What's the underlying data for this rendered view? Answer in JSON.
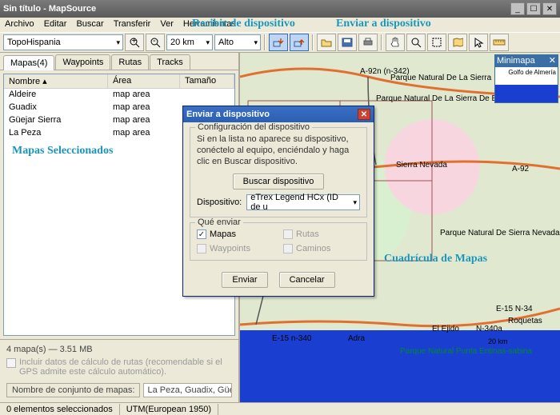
{
  "window": {
    "title": "Sin título - MapSource"
  },
  "menu": {
    "archivo": "Archivo",
    "editar": "Editar",
    "buscar": "Buscar",
    "transferir": "Transferir",
    "ver": "Ver",
    "herramientas": "Herramientas"
  },
  "annotations": {
    "recibir": "Recibir de dispositivo",
    "enviar": "Enviar a dispositivo",
    "mapas_sel": "Mapas Seleccionados",
    "cuadricula": "Cuadrícula de Mapas"
  },
  "toolbar": {
    "product": "TopoHispania",
    "zoom": "20 km",
    "detail": "Alto"
  },
  "tabs": {
    "mapas": "Mapas(4)",
    "waypoints": "Waypoints",
    "rutas": "Rutas",
    "tracks": "Tracks"
  },
  "list": {
    "headers": {
      "nombre": "Nombre",
      "area": "Área",
      "tamano": "Tamaño"
    },
    "rows": [
      {
        "nombre": "Aldeire",
        "area": "map area"
      },
      {
        "nombre": "Guadix",
        "area": "map area"
      },
      {
        "nombre": "Güejar Sierra",
        "area": "map area"
      },
      {
        "nombre": "La Peza",
        "area": "map area"
      }
    ]
  },
  "bottom": {
    "summary": "4 mapa(s) — 3.51 MB",
    "include": "Incluir datos de cálculo de rutas (recomendable si el GPS admite este cálculo automático).",
    "name_label": "Nombre de conjunto de mapas:",
    "name_value": "La Peza, Guadix, Güejar"
  },
  "dialog": {
    "title": "Enviar a dispositivo",
    "group1_legend": "Configuración del dispositivo",
    "group1_text": "Si en la lista no aparece su dispositivo, conéctelo al equipo, enciéndalo y haga clic en Buscar dispositivo.",
    "buscar": "Buscar dispositivo",
    "dispositivo_label": "Dispositivo:",
    "dispositivo_value": "eTrex Legend HCx (ID de u",
    "group2_legend": "Qué enviar",
    "chk_mapas": "Mapas",
    "chk_rutas": "Rutas",
    "chk_waypoints": "Waypoints",
    "chk_caminos": "Caminos",
    "enviar": "Enviar",
    "cancelar": "Cancelar"
  },
  "map_labels": {
    "a92n": "A-92n (n-342)",
    "pn_sierra": "Parque Natural De La Sierra",
    "pn_baza": "Parque Natural De La Sierra De Baza",
    "sierra_nevada": "Sierra Nevada",
    "a92": "A-92",
    "pn_sn": "Parque Natural De Sierra Nevada",
    "e15_n34": "E-15 N-34",
    "n340": "E-15 n-340",
    "n340a": "N-340a",
    "adra": "Adra",
    "ejido": "El Ejido",
    "roquetas": "Roquetas",
    "pn_punta": "Parque Natural Punta Entinas-sabina",
    "scale": "20 km",
    "golfo": "Golfo de Almería"
  },
  "minimap": {
    "title": "Minimapa"
  },
  "status": {
    "selection": "0 elementos seleccionados",
    "datum": "UTM(European 1950)"
  }
}
